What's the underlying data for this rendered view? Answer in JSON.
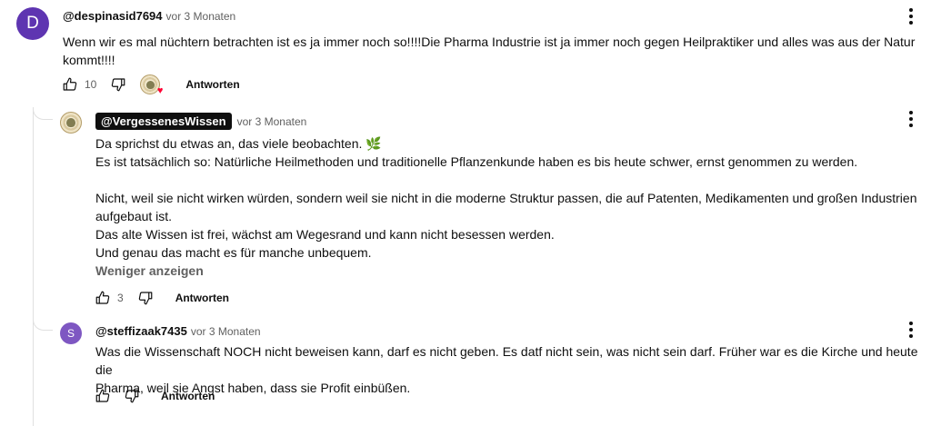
{
  "comment1": {
    "avatar_letter": "D",
    "author": "@despinasid7694",
    "time": "vor 3 Monaten",
    "text_line1": "Wenn wir es mal nüchtern betrachten ist es ja immer noch so!!!!Die Pharma Industrie ist ja immer noch gegen Heilpraktiker und alles was aus der Natur",
    "text_line2": "kommt!!!!",
    "like_count": "10",
    "reply_label": "Antworten"
  },
  "reply1": {
    "author": "@VergessenesWissen",
    "time": "vor 3 Monaten",
    "lines": [
      "Da sprichst du etwas an, das viele beobachten. 🌿",
      "Es ist tatsächlich so: Natürliche Heilmethoden und traditionelle Pflanzenkunde haben es bis heute schwer, ernst genommen zu werden.",
      "",
      "Nicht, weil sie nicht wirken würden, sondern weil sie nicht in die moderne Struktur passen, die auf Patenten, Medikamenten und großen Industrien",
      "aufgebaut ist.",
      "Das alte Wissen ist frei, wächst am Wegesrand und kann nicht besessen werden.",
      "Und genau das macht es für manche unbequem."
    ],
    "show_less": "Weniger anzeigen",
    "like_count": "3",
    "reply_label": "Antworten"
  },
  "reply2": {
    "avatar_letter": "S",
    "author": "@steffizaak7435",
    "time": "vor 3 Monaten",
    "text_line1": "Was die Wissenschaft NOCH nicht beweisen kann, darf es nicht geben. Es datf nicht sein, was nicht sein darf. Früher war es die Kirche und heute die",
    "text_line2": "Pharma, weil sie Angst haben, dass sie Profit einbüßen.",
    "reply_label": "Antworten"
  },
  "icons": {
    "like": "thumb-up-icon",
    "dislike": "thumb-down-icon",
    "menu": "more-vertical-icon",
    "creator_heart": "heart-icon"
  },
  "colors": {
    "creator_heart": "#ff0033",
    "avatar_d": "#5e35b1",
    "avatar_s": "#7e57c2",
    "channel_tag_bg": "#0f0f0f"
  }
}
